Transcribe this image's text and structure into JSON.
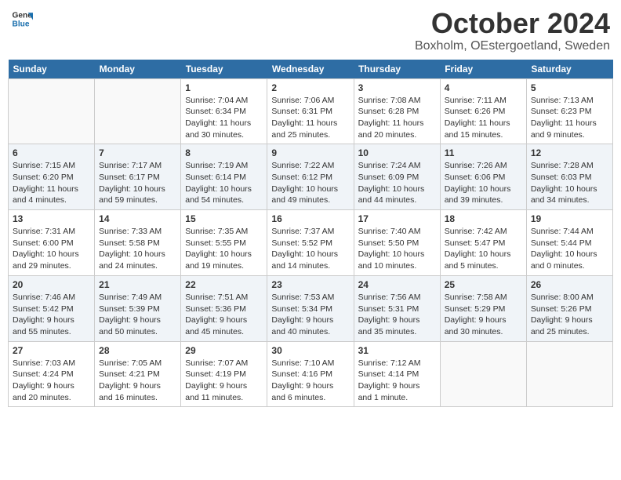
{
  "header": {
    "logo_line1": "General",
    "logo_line2": "Blue",
    "month": "October 2024",
    "location": "Boxholm, OEstergoetland, Sweden"
  },
  "weekdays": [
    "Sunday",
    "Monday",
    "Tuesday",
    "Wednesday",
    "Thursday",
    "Friday",
    "Saturday"
  ],
  "weeks": [
    [
      {
        "day": "",
        "text": ""
      },
      {
        "day": "",
        "text": ""
      },
      {
        "day": "1",
        "text": "Sunrise: 7:04 AM\nSunset: 6:34 PM\nDaylight: 11 hours and 30 minutes."
      },
      {
        "day": "2",
        "text": "Sunrise: 7:06 AM\nSunset: 6:31 PM\nDaylight: 11 hours and 25 minutes."
      },
      {
        "day": "3",
        "text": "Sunrise: 7:08 AM\nSunset: 6:28 PM\nDaylight: 11 hours and 20 minutes."
      },
      {
        "day": "4",
        "text": "Sunrise: 7:11 AM\nSunset: 6:26 PM\nDaylight: 11 hours and 15 minutes."
      },
      {
        "day": "5",
        "text": "Sunrise: 7:13 AM\nSunset: 6:23 PM\nDaylight: 11 hours and 9 minutes."
      }
    ],
    [
      {
        "day": "6",
        "text": "Sunrise: 7:15 AM\nSunset: 6:20 PM\nDaylight: 11 hours and 4 minutes."
      },
      {
        "day": "7",
        "text": "Sunrise: 7:17 AM\nSunset: 6:17 PM\nDaylight: 10 hours and 59 minutes."
      },
      {
        "day": "8",
        "text": "Sunrise: 7:19 AM\nSunset: 6:14 PM\nDaylight: 10 hours and 54 minutes."
      },
      {
        "day": "9",
        "text": "Sunrise: 7:22 AM\nSunset: 6:12 PM\nDaylight: 10 hours and 49 minutes."
      },
      {
        "day": "10",
        "text": "Sunrise: 7:24 AM\nSunset: 6:09 PM\nDaylight: 10 hours and 44 minutes."
      },
      {
        "day": "11",
        "text": "Sunrise: 7:26 AM\nSunset: 6:06 PM\nDaylight: 10 hours and 39 minutes."
      },
      {
        "day": "12",
        "text": "Sunrise: 7:28 AM\nSunset: 6:03 PM\nDaylight: 10 hours and 34 minutes."
      }
    ],
    [
      {
        "day": "13",
        "text": "Sunrise: 7:31 AM\nSunset: 6:00 PM\nDaylight: 10 hours and 29 minutes."
      },
      {
        "day": "14",
        "text": "Sunrise: 7:33 AM\nSunset: 5:58 PM\nDaylight: 10 hours and 24 minutes."
      },
      {
        "day": "15",
        "text": "Sunrise: 7:35 AM\nSunset: 5:55 PM\nDaylight: 10 hours and 19 minutes."
      },
      {
        "day": "16",
        "text": "Sunrise: 7:37 AM\nSunset: 5:52 PM\nDaylight: 10 hours and 14 minutes."
      },
      {
        "day": "17",
        "text": "Sunrise: 7:40 AM\nSunset: 5:50 PM\nDaylight: 10 hours and 10 minutes."
      },
      {
        "day": "18",
        "text": "Sunrise: 7:42 AM\nSunset: 5:47 PM\nDaylight: 10 hours and 5 minutes."
      },
      {
        "day": "19",
        "text": "Sunrise: 7:44 AM\nSunset: 5:44 PM\nDaylight: 10 hours and 0 minutes."
      }
    ],
    [
      {
        "day": "20",
        "text": "Sunrise: 7:46 AM\nSunset: 5:42 PM\nDaylight: 9 hours and 55 minutes."
      },
      {
        "day": "21",
        "text": "Sunrise: 7:49 AM\nSunset: 5:39 PM\nDaylight: 9 hours and 50 minutes."
      },
      {
        "day": "22",
        "text": "Sunrise: 7:51 AM\nSunset: 5:36 PM\nDaylight: 9 hours and 45 minutes."
      },
      {
        "day": "23",
        "text": "Sunrise: 7:53 AM\nSunset: 5:34 PM\nDaylight: 9 hours and 40 minutes."
      },
      {
        "day": "24",
        "text": "Sunrise: 7:56 AM\nSunset: 5:31 PM\nDaylight: 9 hours and 35 minutes."
      },
      {
        "day": "25",
        "text": "Sunrise: 7:58 AM\nSunset: 5:29 PM\nDaylight: 9 hours and 30 minutes."
      },
      {
        "day": "26",
        "text": "Sunrise: 8:00 AM\nSunset: 5:26 PM\nDaylight: 9 hours and 25 minutes."
      }
    ],
    [
      {
        "day": "27",
        "text": "Sunrise: 7:03 AM\nSunset: 4:24 PM\nDaylight: 9 hours and 20 minutes."
      },
      {
        "day": "28",
        "text": "Sunrise: 7:05 AM\nSunset: 4:21 PM\nDaylight: 9 hours and 16 minutes."
      },
      {
        "day": "29",
        "text": "Sunrise: 7:07 AM\nSunset: 4:19 PM\nDaylight: 9 hours and 11 minutes."
      },
      {
        "day": "30",
        "text": "Sunrise: 7:10 AM\nSunset: 4:16 PM\nDaylight: 9 hours and 6 minutes."
      },
      {
        "day": "31",
        "text": "Sunrise: 7:12 AM\nSunset: 4:14 PM\nDaylight: 9 hours and 1 minute."
      },
      {
        "day": "",
        "text": ""
      },
      {
        "day": "",
        "text": ""
      }
    ]
  ]
}
